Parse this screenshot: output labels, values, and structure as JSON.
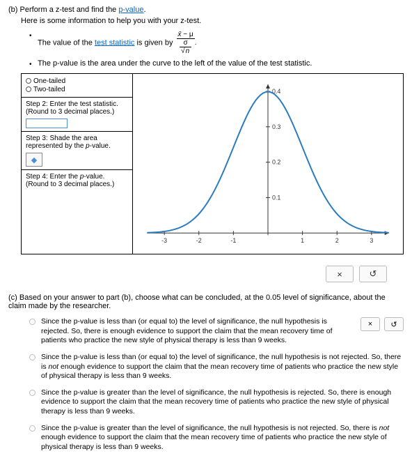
{
  "partB": {
    "label": "(b)",
    "main_text": "Perform a z-test and find the ",
    "link_text": "p-value",
    "main_text_end": ".",
    "sub_text": "Here is some information to help you with your z-test.",
    "bullet1_pre": "The value of the ",
    "bullet1_link": "test statistic",
    "bullet1_post": " is given by ",
    "bullet2": "The p-value is the area under the curve to the left of the value of the test statistic."
  },
  "steps": {
    "one_tailed": "One-tailed",
    "two_tailed": "Two-tailed",
    "step2_l1": "Step 2: Enter the test statistic.",
    "step2_l2": "(Round to 3 decimal places.)",
    "step3_l1": "Step 3: Shade the area represented by the ",
    "step3_l2": "p",
    "step3_l3": "-value.",
    "step4_l1": "Step 4: Enter the ",
    "step4_l2": "p",
    "step4_l3": "-value.",
    "step4_l4": "(Round to 3 decimal places.)"
  },
  "chart_data": {
    "type": "line",
    "title": "",
    "xlabel": "",
    "ylabel": "",
    "xlim": [
      -3.5,
      3.5
    ],
    "ylim": [
      0,
      0.42
    ],
    "x_ticks": [
      -3,
      -2,
      -1,
      0,
      1,
      2,
      3
    ],
    "y_ticks": [
      0.1,
      0.2,
      0.3,
      0.4
    ],
    "series": [
      {
        "name": "normal-pdf",
        "x": [
          -3.5,
          -3,
          -2.5,
          -2,
          -1.5,
          -1,
          -0.5,
          0,
          0.5,
          1,
          1.5,
          2,
          2.5,
          3,
          3.5
        ],
        "y": [
          0.0009,
          0.0044,
          0.0175,
          0.054,
          0.1295,
          0.242,
          0.3521,
          0.3989,
          0.3521,
          0.242,
          0.1295,
          0.054,
          0.0175,
          0.0044,
          0.0009
        ]
      }
    ]
  },
  "buttons": {
    "close": "×",
    "reset": "↺"
  },
  "partC": {
    "label": "(c)",
    "intro_1": "Based on your answer to part (b), choose what can be concluded, at the ",
    "intro_level": "0.05",
    "intro_2": " level of significance, about the claim made by the researcher.",
    "opt1": "Since the p-value is less than (or equal to) the level of significance, the null hypothesis is rejected. So, there is enough evidence to support the claim that the mean recovery time of patients who practice the new style of physical therapy is less than 9 weeks.",
    "opt2_a": "Since the p-value is less than (or equal to) the level of significance, the null hypothesis is not rejected. So, there is ",
    "opt2_not": "not",
    "opt2_b": " enough evidence to support the claim that the mean recovery time of patients who practice the new style of physical therapy is less than 9 weeks.",
    "opt3": "Since the p-value is greater than the level of significance, the null hypothesis is rejected. So, there is enough evidence to support the claim that the mean recovery time of patients who practice the new style of physical therapy is less than 9 weeks.",
    "opt4_a": "Since the p-value is greater than the level of significance, the null hypothesis is not rejected. So, there is ",
    "opt4_not": "not",
    "opt4_b": " enough evidence to support the claim that the mean recovery time of patients who practice the new style of physical therapy is less than 9 weeks."
  }
}
